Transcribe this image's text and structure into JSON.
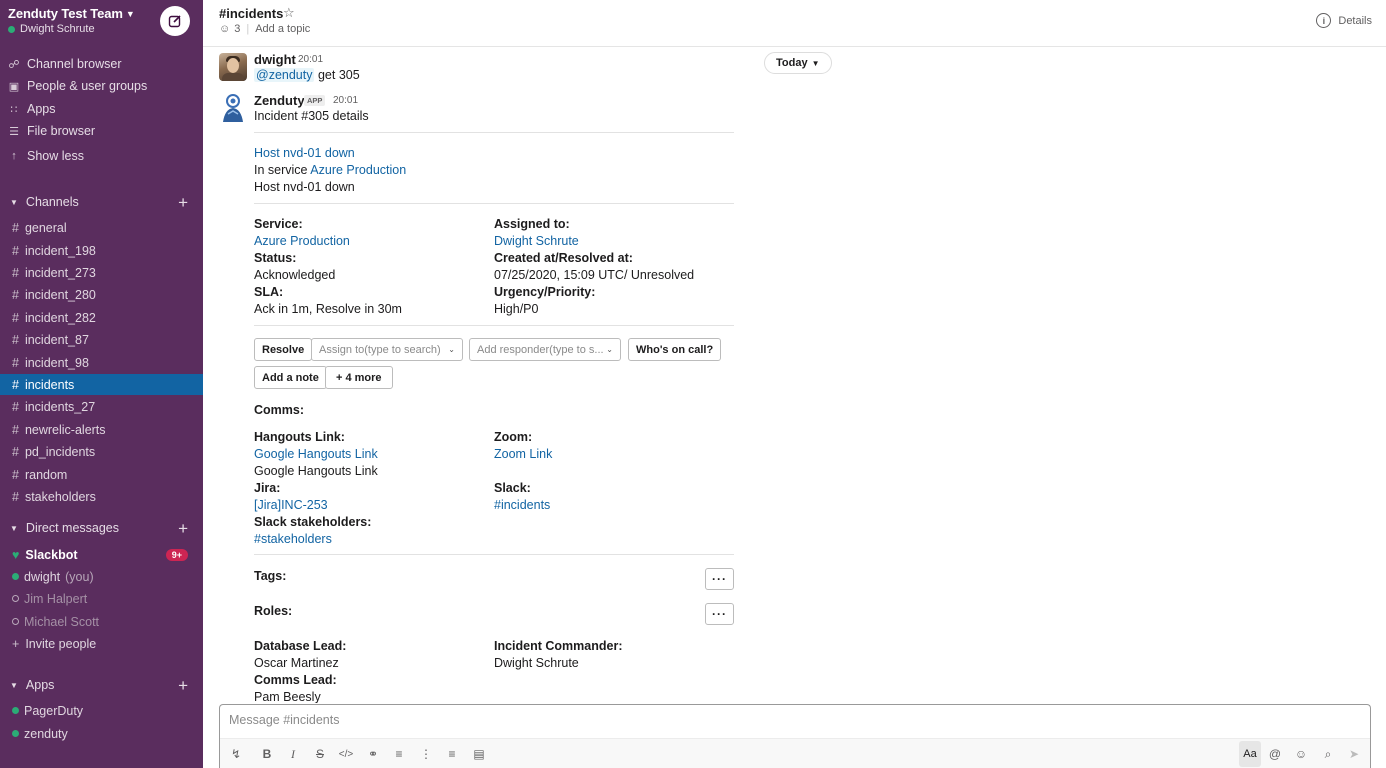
{
  "workspace": {
    "name": "Zenduty Test Team",
    "user": "Dwight Schrute"
  },
  "sidebar": {
    "nav": [
      {
        "label": "Channel browser",
        "icon": "channel-browser-icon"
      },
      {
        "label": "People & user groups",
        "icon": "people-icon"
      },
      {
        "label": "Apps",
        "icon": "apps-grid-icon"
      },
      {
        "label": "File browser",
        "icon": "files-icon"
      },
      {
        "label": "Show less",
        "icon": "arrow-up-icon"
      }
    ],
    "channels_label": "Channels",
    "channels": [
      "general",
      "incident_198",
      "incident_273",
      "incident_280",
      "incident_282",
      "incident_87",
      "incident_98",
      "incidents",
      "incidents_27",
      "newrelic-alerts",
      "pd_incidents",
      "random",
      "stakeholders"
    ],
    "active_channel": "incidents",
    "dm_label": "Direct messages",
    "dms": [
      {
        "name": "Slackbot",
        "badge": "9+"
      },
      {
        "name": "dwight",
        "suffix": "(you)"
      },
      {
        "name": "Jim Halpert"
      },
      {
        "name": "Michael Scott"
      }
    ],
    "invite_label": "Invite people",
    "apps_label": "Apps",
    "apps": [
      "PagerDuty",
      "zenduty"
    ]
  },
  "header": {
    "channel": "#incidents",
    "members": "3",
    "topic_placeholder": "Add a topic",
    "details_label": "Details"
  },
  "divider": {
    "label": "Today"
  },
  "message1": {
    "sender": "dwight",
    "time": "20:01",
    "mention": "@zenduty",
    "text": "get 305"
  },
  "message2": {
    "sender": "Zenduty",
    "app_tag": "APP",
    "time": "20:01",
    "intro": "Incident #305 details",
    "incident_title": "Host nvd-01 down",
    "service_prefix": "In service",
    "service_link": "Azure Production",
    "summary": "Host nvd-01 down",
    "fields": {
      "service_label": "Service:",
      "service_value": "Azure Production",
      "assigned_label": "Assigned to:",
      "assigned_value": "Dwight Schrute",
      "status_label": "Status:",
      "status_value": "Acknowledged",
      "created_label": "Created at/Resolved at:",
      "created_value": "07/25/2020, 15:09 UTC/ Unresolved",
      "sla_label": "SLA:",
      "sla_value": "Ack in 1m, Resolve in 30m",
      "urgency_label": "Urgency/Priority:",
      "urgency_value": "High/P0"
    },
    "actions": {
      "resolve": "Resolve",
      "assign_placeholder": "Assign to(type to search)",
      "responder_placeholder": "Add responder(type to s...",
      "oncall": "Who's on call?",
      "note": "Add a note",
      "more": "+ 4 more"
    },
    "comms": {
      "title": "Comms:",
      "hangouts_label": "Hangouts Link:",
      "hangouts_link": "Google Hangouts Link",
      "hangouts_text": "Google Hangouts Link",
      "zoom_label": "Zoom:",
      "zoom_link": "Zoom Link",
      "jira_label": "Jira:",
      "jira_link": "[Jira]INC-253",
      "slack_label": "Slack:",
      "slack_link": "#incidents",
      "stakeholders_label": "Slack stakeholders:",
      "stakeholders_link": "#stakeholders"
    },
    "tags_label": "Tags:",
    "roles_label": "Roles:",
    "roles": {
      "db_label": "Database Lead:",
      "db_value": "Oscar Martinez",
      "ic_label": "Incident Commander:",
      "ic_value": "Dwight Schrute",
      "comms_label": "Comms Lead:",
      "comms_value": "Pam Beesly"
    }
  },
  "composer": {
    "placeholder": "Message #incidents",
    "format_label": "Aa"
  },
  "colors": {
    "sidebar": "#5a2d5e",
    "active": "#1264a3",
    "link": "#1264a3",
    "badge": "#cd2553",
    "presence": "#2bac76"
  }
}
